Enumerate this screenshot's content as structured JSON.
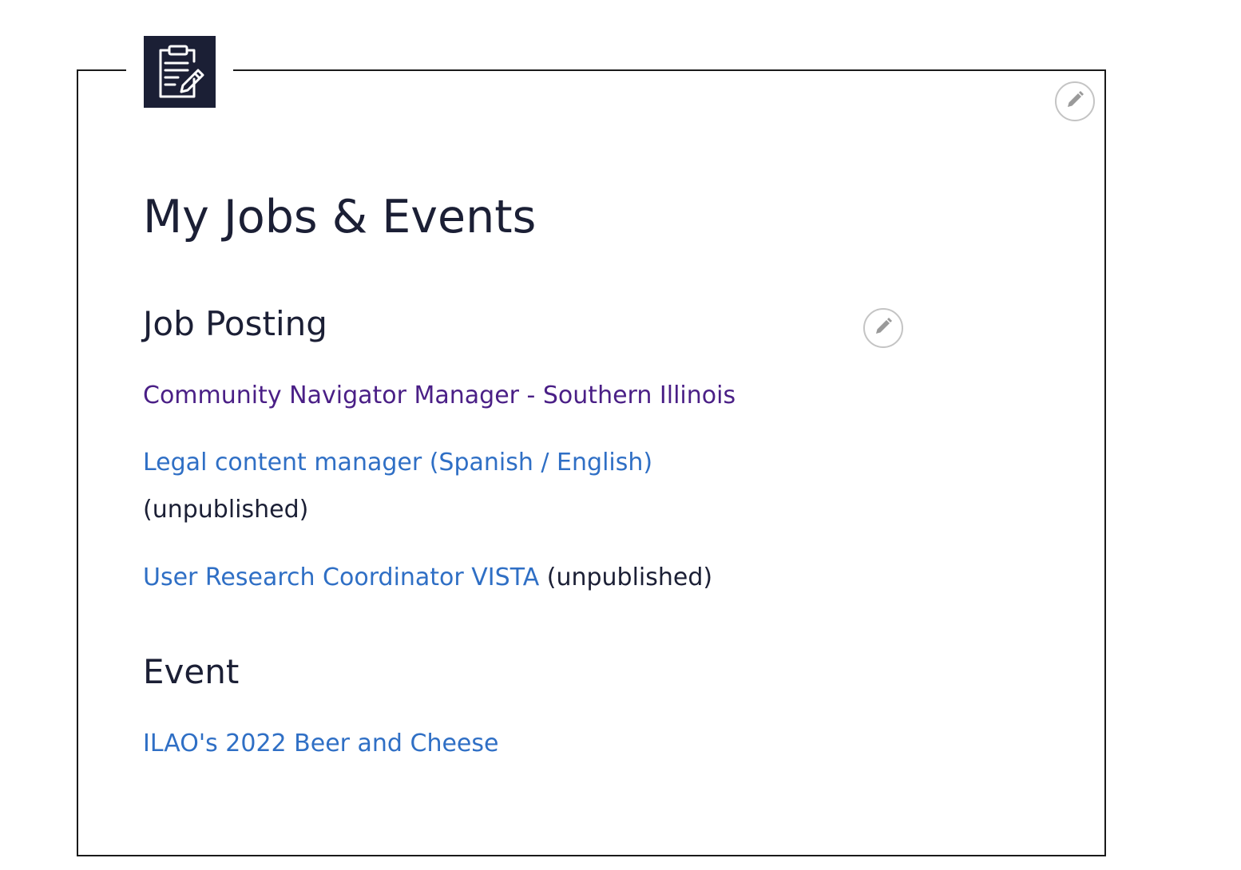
{
  "page": {
    "title": "My Jobs & Events"
  },
  "icons": {
    "header": "clipboard-edit-icon",
    "edit": "pencil-icon"
  },
  "colors": {
    "badge_bg": "#1b1f35",
    "link": "#2f6fc5",
    "link_visited": "#4a1f86",
    "text": "#1b1f35"
  },
  "jobs": {
    "heading": "Job Posting",
    "items": [
      {
        "title": "Community Navigator Manager - Southern Illinois",
        "status": ""
      },
      {
        "title": "Legal content manager (Spanish / English)",
        "status": "(unpublished)"
      },
      {
        "title": "User Research Coordinator VISTA",
        "status": "(unpublished)"
      }
    ]
  },
  "events": {
    "heading": "Event",
    "items": [
      {
        "title": "ILAO's 2022 Beer and Cheese",
        "status": ""
      }
    ]
  }
}
